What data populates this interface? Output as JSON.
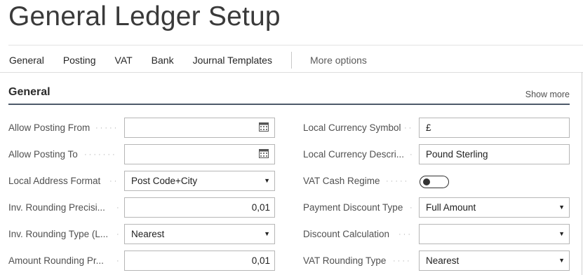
{
  "page": {
    "title": "General Ledger Setup"
  },
  "actions": {
    "items": [
      "General",
      "Posting",
      "VAT",
      "Bank",
      "Journal Templates"
    ],
    "more": "More options"
  },
  "section": {
    "title": "General",
    "show_more": "Show more"
  },
  "left_fields": [
    {
      "label": "Allow Posting From",
      "value": "",
      "control": "date"
    },
    {
      "label": "Allow Posting To",
      "value": "",
      "control": "date"
    },
    {
      "label": "Local Address Format",
      "value": "Post Code+City",
      "control": "dropdown"
    },
    {
      "label": "Inv. Rounding Precisi...",
      "value": "0,01",
      "control": "number"
    },
    {
      "label": "Inv. Rounding Type (L...",
      "value": "Nearest",
      "control": "dropdown"
    },
    {
      "label": "Amount Rounding Pr...",
      "value": "0,01",
      "control": "number"
    }
  ],
  "right_fields": [
    {
      "label": "Local Currency Symbol",
      "value": "£",
      "control": "text"
    },
    {
      "label": "Local Currency Descri...",
      "value": "Pound Sterling",
      "control": "text"
    },
    {
      "label": "VAT Cash Regime",
      "value": false,
      "control": "toggle"
    },
    {
      "label": "Payment Discount Type",
      "value": "Full Amount",
      "control": "dropdown"
    },
    {
      "label": "Discount Calculation",
      "value": "",
      "control": "dropdown"
    },
    {
      "label": "VAT Rounding Type",
      "value": "Nearest",
      "control": "dropdown"
    }
  ],
  "icons": {
    "date": "calendar-icon",
    "dropdown": "dropdown-arrow-icon"
  }
}
